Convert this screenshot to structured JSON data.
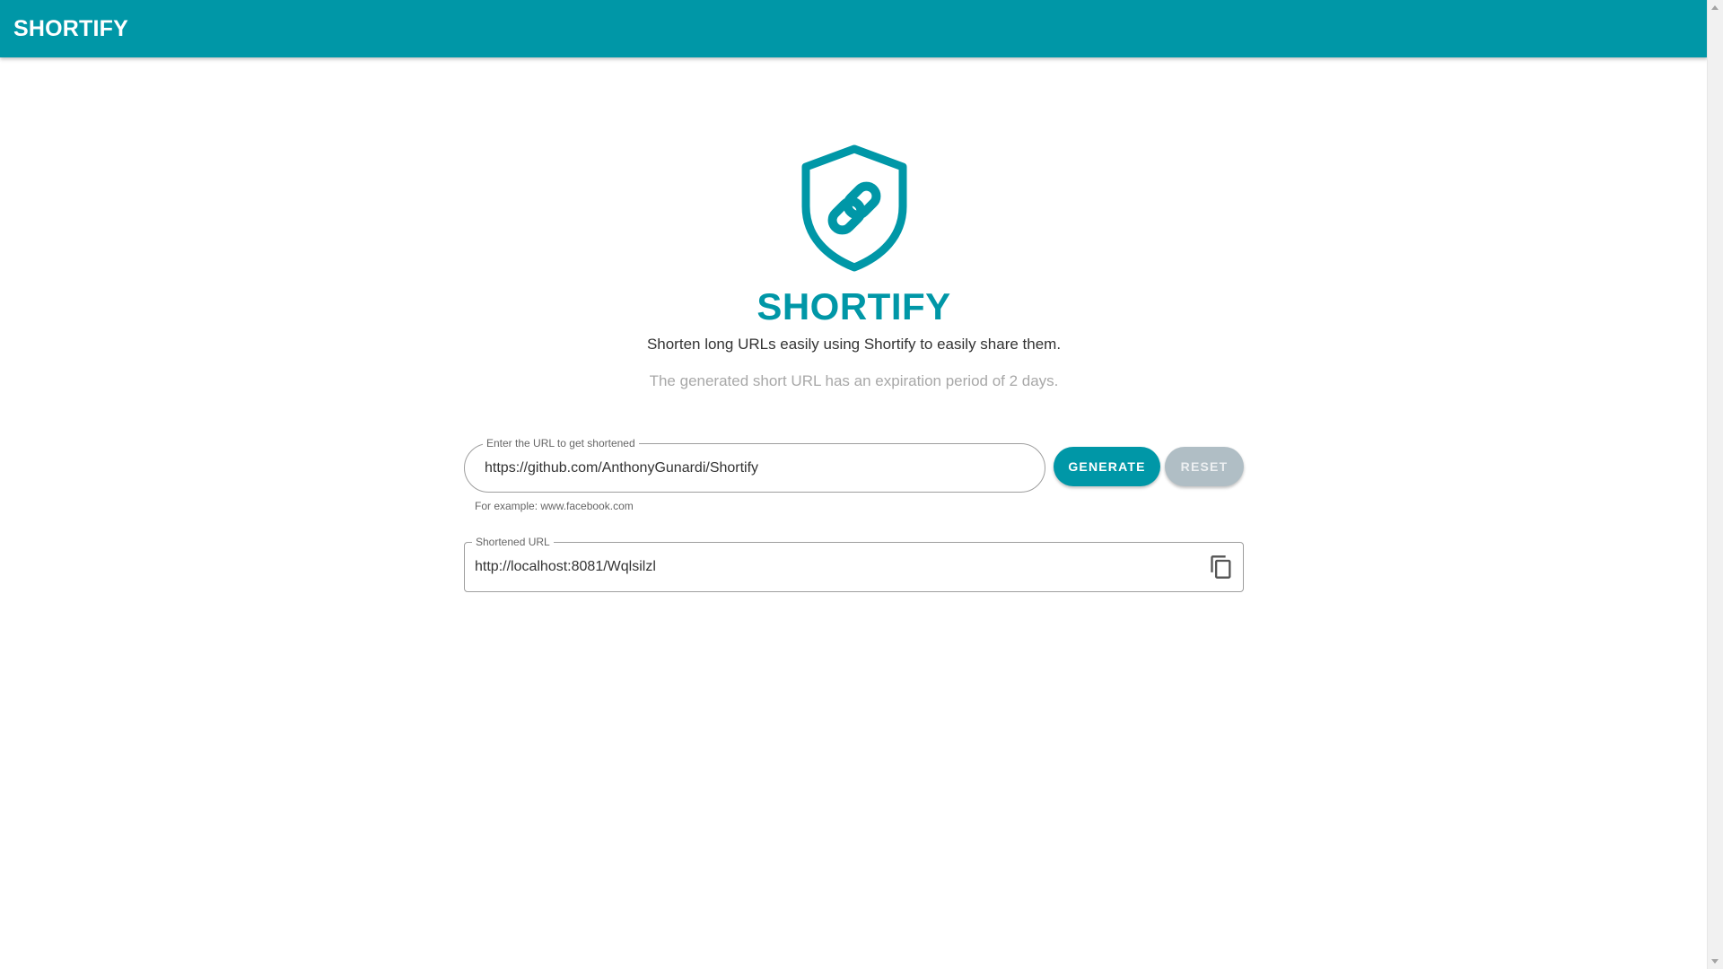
{
  "app_bar": {
    "title": "SHORTIFY",
    "color": "#0097a7"
  },
  "hero": {
    "logo_icon": "shield-link-icon",
    "title": "SHORTIFY",
    "subtitle": "Shorten long URLs easily using Shortify to easily share them.",
    "note": "The generated short URL has an expiration period of 2 days."
  },
  "url_form": {
    "label": "Enter the URL to get shortened",
    "value": "https://github.com/AnthonyGunardi/Shortify",
    "hint": "For example: www.facebook.com",
    "generate_label": "GENERATE",
    "reset_label": "RESET"
  },
  "result": {
    "label": "Shortened URL",
    "value": "http://localhost:8081/Wqlsilzl",
    "copy_icon": "copy-icon"
  },
  "colors": {
    "primary": "#0097a7",
    "disabled_button": "#b0bec5"
  }
}
